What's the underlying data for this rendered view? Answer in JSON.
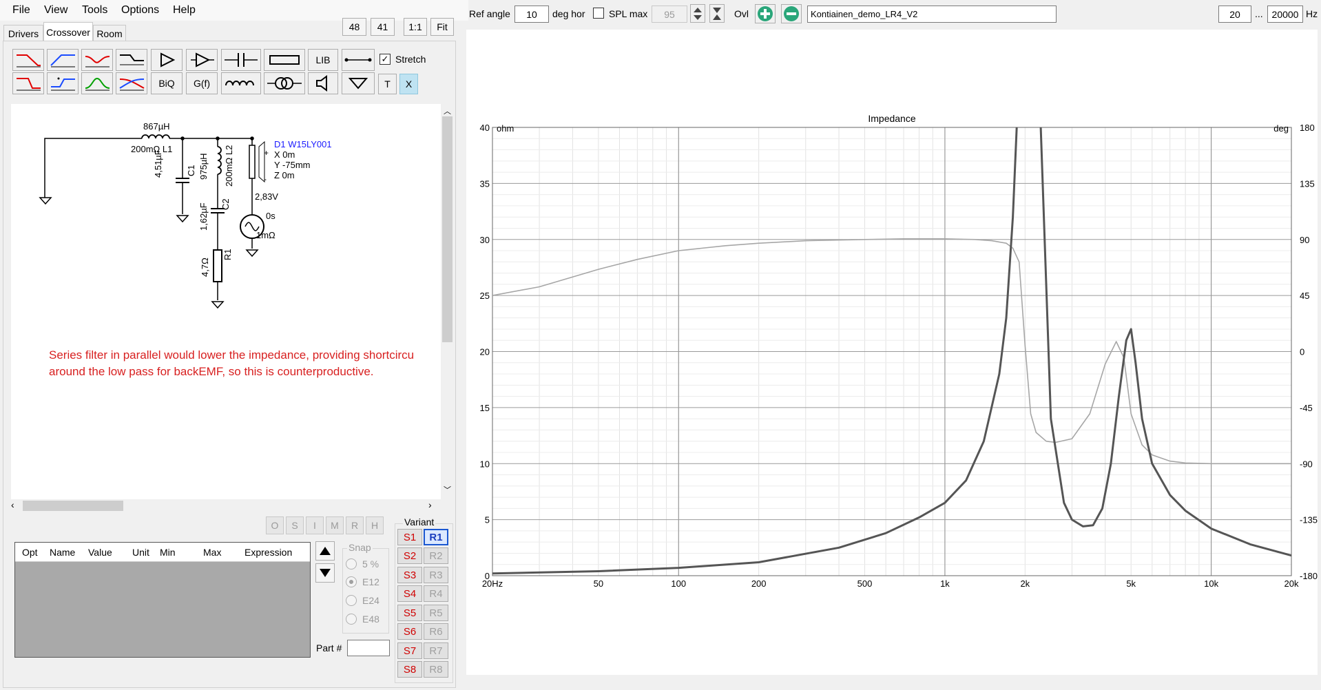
{
  "menu": [
    "File",
    "View",
    "Tools",
    "Options",
    "Help"
  ],
  "tabs": [
    "Drivers",
    "Crossover",
    "Room"
  ],
  "top_small_buttons": [
    "48",
    "41",
    "1:1",
    "Fit"
  ],
  "toolbar": {
    "lib_label": "LIB",
    "biq_label": "BiQ",
    "gf_label": "G(f)",
    "t_label": "T",
    "x_label": "X",
    "stretch_label": "Stretch"
  },
  "schematic": {
    "l1_value": "867µH",
    "l1_label": "200mΩ L1",
    "c1_value": "4,51µF",
    "c1_label": "C1",
    "l2_value": "975µH",
    "l2_label": "200mΩ L2",
    "c2_value": "1,62µF",
    "c2_label": "C2",
    "r1_value": "4,7Ω",
    "r1_label": "R1",
    "driver_name": "D1 W15LY001",
    "driver_x": "X 0m",
    "driver_y": "Y -75mm",
    "driver_z": "Z 0m",
    "src_voltage": "2,83V",
    "src_delay": "0s",
    "src_resistance": "1mΩ",
    "note_line1": "Series filter in parallel would lower the impedance, providing shortcircu",
    "note_line2": "around the low pass for backEMF, so this is counterproductive."
  },
  "opt_buttons": [
    "O",
    "S",
    "I",
    "M",
    "R",
    "H"
  ],
  "table_headers": [
    "Opt",
    "Name",
    "Value",
    "Unit",
    "Min",
    "Max",
    "Expression"
  ],
  "snap": {
    "title": "Snap",
    "options": [
      "5 %",
      "E12",
      "E24",
      "E48"
    ],
    "selected": "E12"
  },
  "part_label": "Part #",
  "part_value": "",
  "variant": {
    "title": "Variant",
    "s": [
      "S1",
      "S2",
      "S3",
      "S4",
      "S5",
      "S6",
      "S7",
      "S8"
    ],
    "r": [
      "R1",
      "R2",
      "R3",
      "R4",
      "R5",
      "R6",
      "R7",
      "R8"
    ],
    "selected": "R1"
  },
  "graph_toolbar": {
    "ref_angle_label": "Ref angle",
    "ref_angle_value": "10",
    "deg_hor_label": "deg hor",
    "spl_max_label": "SPL max",
    "spl_max_value": "95",
    "ovl_label": "Ovl",
    "project_name": "Kontiainen_demo_LR4_V2",
    "freq_min": "20",
    "freq_sep": "...",
    "freq_max": "20000",
    "hz_label": "Hz"
  },
  "chart_data": {
    "type": "line",
    "title": "Impedance",
    "ylabel_left": "ohm",
    "ylabel_right": "deg",
    "x_scale": "log",
    "xlim": [
      20,
      20000
    ],
    "ylim_left": [
      0,
      40
    ],
    "ylim_right": [
      -180,
      180
    ],
    "x_tick_labels": [
      "20Hz",
      "50",
      "100",
      "200",
      "500",
      "1k",
      "2k",
      "5k",
      "10k",
      "20k"
    ],
    "x_tick_values": [
      20,
      50,
      100,
      200,
      500,
      1000,
      2000,
      5000,
      10000,
      20000
    ],
    "y_left_ticks": [
      0,
      5,
      10,
      15,
      20,
      25,
      30,
      35,
      40
    ],
    "y_right_ticks": [
      -180,
      -135,
      -90,
      -45,
      0,
      45,
      90,
      135,
      180
    ],
    "grid": true,
    "series": [
      {
        "axis": "left",
        "color": "#555555",
        "x": [
          20,
          50,
          100,
          200,
          400,
          600,
          800,
          1000,
          1200,
          1400,
          1600,
          1700,
          1800,
          1900,
          2000,
          2200,
          2500,
          2800,
          3000,
          3300,
          3600,
          3900,
          4200,
          4500,
          4800,
          5000,
          5200,
          5500,
          6000,
          7000,
          8000,
          10000,
          14000,
          20000
        ],
        "values": [
          0.2,
          0.4,
          0.7,
          1.2,
          2.5,
          3.8,
          5.2,
          6.5,
          8.5,
          12,
          18,
          23,
          32,
          45,
          60,
          52,
          14,
          6.5,
          5.0,
          4.4,
          4.5,
          6,
          10,
          16,
          21,
          22,
          19,
          14,
          10,
          7.2,
          5.8,
          4.2,
          2.8,
          1.8
        ]
      },
      {
        "axis": "right",
        "color": "#a6a6a6",
        "x": [
          20,
          30,
          50,
          70,
          100,
          150,
          200,
          300,
          500,
          700,
          1000,
          1300,
          1500,
          1700,
          1800,
          1900,
          2000,
          2100,
          2200,
          2400,
          2600,
          3000,
          3500,
          4000,
          4400,
          4700,
          5000,
          5500,
          6000,
          7000,
          8000,
          10000,
          14000,
          20000
        ],
        "values": [
          45,
          52,
          66,
          74,
          81,
          85,
          87,
          89,
          90,
          90.5,
          90.5,
          90,
          89,
          87,
          83,
          72,
          5,
          -50,
          -65,
          -72,
          -73,
          -70,
          -50,
          -10,
          8,
          -5,
          -50,
          -75,
          -83,
          -88,
          -89.5,
          -90,
          -90,
          -90
        ]
      }
    ]
  }
}
